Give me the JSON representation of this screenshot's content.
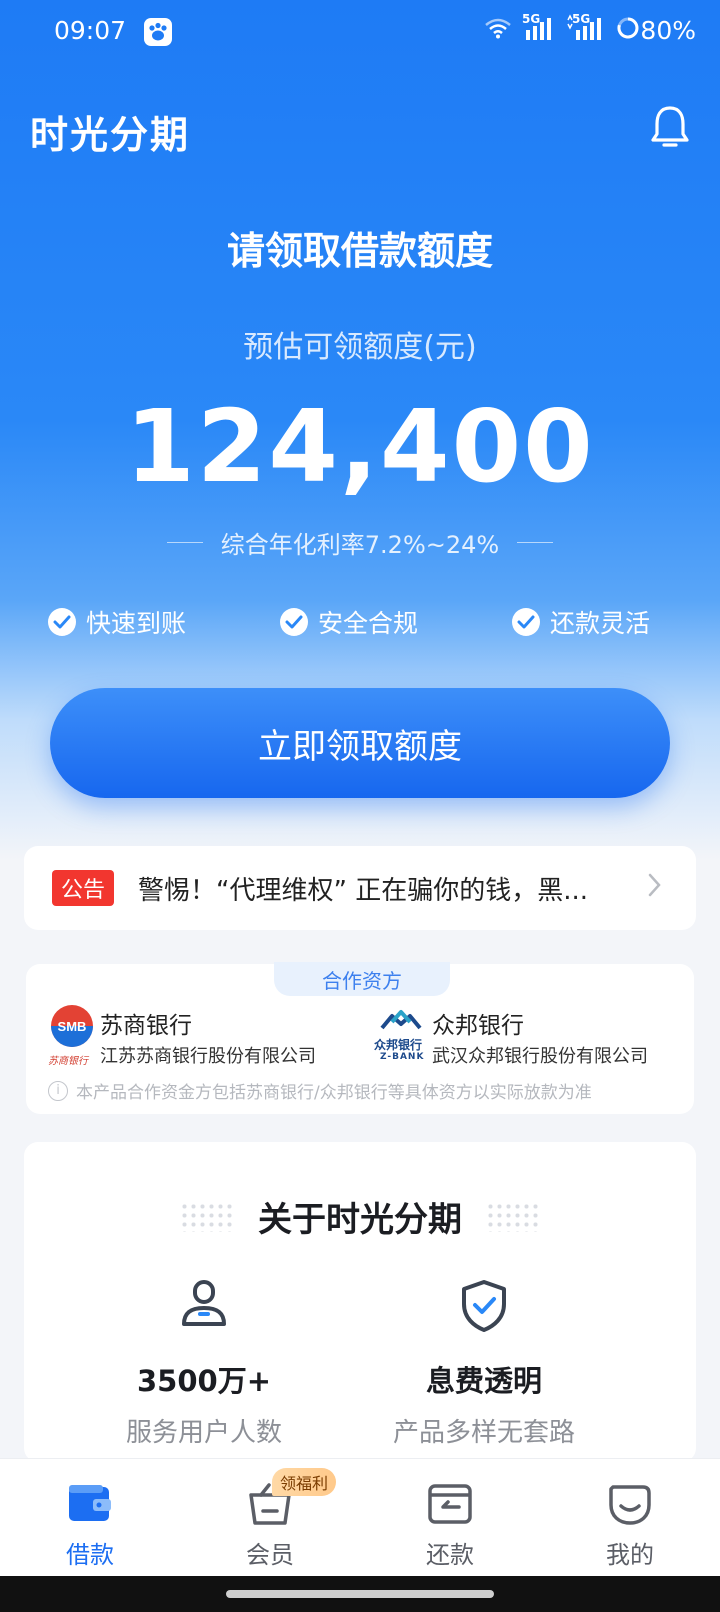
{
  "status_bar": {
    "time": "09:07",
    "network_1": "5G",
    "network_2": "5G",
    "battery": "80%"
  },
  "header": {
    "brand": "时光分期",
    "bell_icon": "bell-icon"
  },
  "hero": {
    "title": "请领取借款额度",
    "estimate_label": "预估可领额度(元)",
    "amount": "124,400",
    "rate": "综合年化利率7.2%~24%",
    "features": [
      "快速到账",
      "安全合规",
      "还款灵活"
    ],
    "cta": "立即领取额度"
  },
  "notice": {
    "tag": "公告",
    "text": "警惕！“代理维权” 正在骗你的钱，黑..."
  },
  "partners": {
    "title": "合作资方",
    "banks": [
      {
        "name": "苏商银行",
        "full_name": "江苏苏商银行股份有限公司",
        "logo_text": "SMB",
        "logo_caption": "苏商银行"
      },
      {
        "name": "众邦银行",
        "full_name": "武汉众邦银行股份有限公司",
        "logo_text": "众邦银行",
        "logo_caption": "Z-BANK"
      }
    ],
    "note": "本产品合作资金方包括苏商银行/众邦银行等具体资方以实际放款为准"
  },
  "about": {
    "title": "关于时光分期",
    "stats": [
      {
        "value": "3500万+",
        "label": "服务用户人数",
        "icon": "user-icon"
      },
      {
        "value": "息费透明",
        "label": "产品多样无套路",
        "icon": "shield-check-icon"
      }
    ]
  },
  "tabbar": {
    "tabs": [
      {
        "label": "借款",
        "icon": "wallet-icon",
        "active": true
      },
      {
        "label": "会员",
        "icon": "basket-icon",
        "active": false
      },
      {
        "label": "还款",
        "icon": "card-return-icon",
        "active": false
      },
      {
        "label": "我的",
        "icon": "profile-face-icon",
        "active": false
      }
    ],
    "badge": "领福利"
  },
  "colors": {
    "brand_blue": "#1e7bf5",
    "cta_blue": "#1767ef",
    "notice_red": "#f2362f",
    "tab_active": "#1c6ef2"
  }
}
